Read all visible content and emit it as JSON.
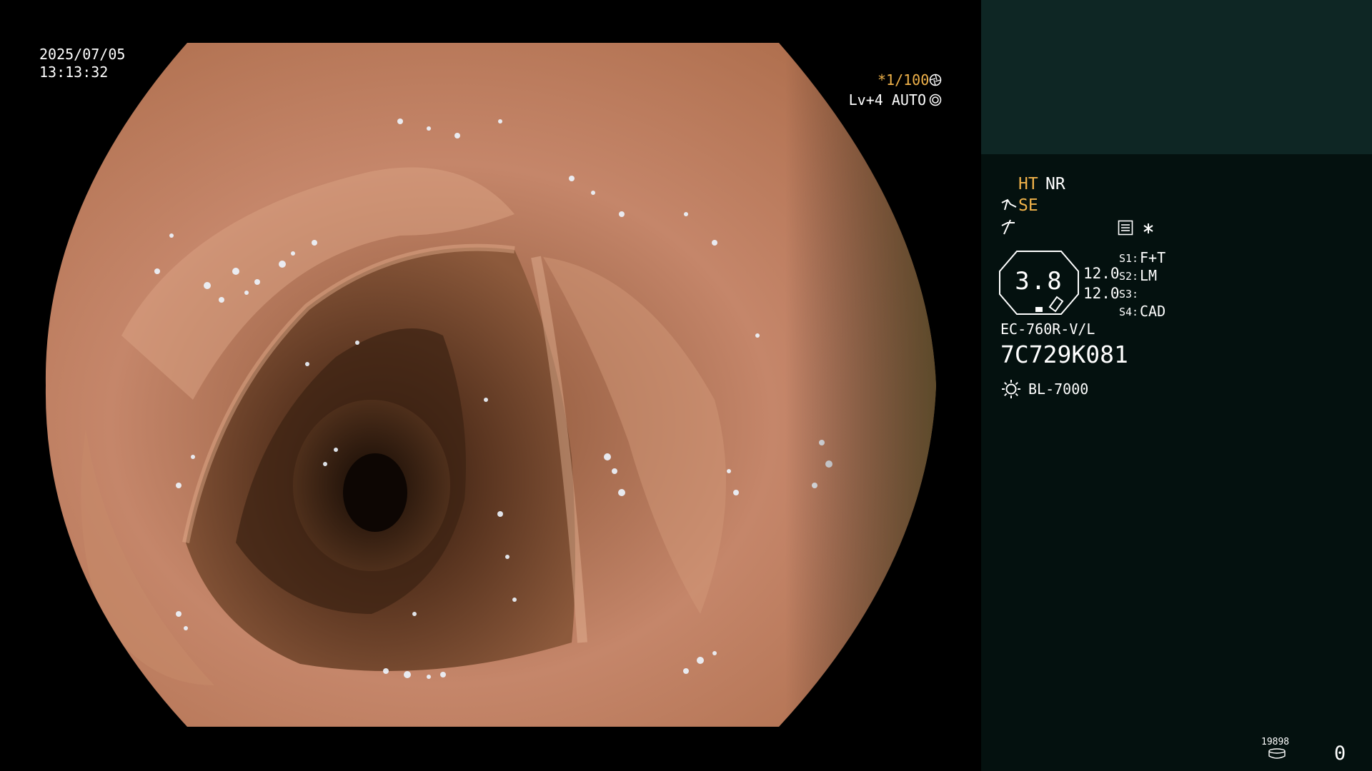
{
  "overlay": {
    "date": "2025/07/05",
    "time": "13:13:32",
    "shutter": "*1/100",
    "level": "Lv+4 AUTO"
  },
  "panel": {
    "ht": "HT",
    "nr": "NR",
    "se": "SE",
    "zoom_value": "3.8",
    "readout_1": "12.0",
    "readout_2": "12.0",
    "s1_label": "S1:",
    "s1_value": "F+T",
    "s2_label": "S2:",
    "s2_value": "LM",
    "s3_label": "S3:",
    "s3_value": "",
    "s4_label": "S4:",
    "s4_value": "CAD",
    "scope_model": "EC-760R-V/L",
    "scope_serial": "7C729K081",
    "light_source": "BL-7000",
    "counter_small": "19898",
    "counter_main": "0"
  },
  "colors": {
    "accent_amber": "#f0b24a",
    "panel_bg": "#04110f",
    "panel_top_bg": "#0e2624"
  },
  "icons": [
    "shutter-icon",
    "auto-exposure-icon",
    "cable-icon",
    "signal-icon",
    "settings-menu-icon",
    "light-source-icon",
    "storage-icon"
  ]
}
